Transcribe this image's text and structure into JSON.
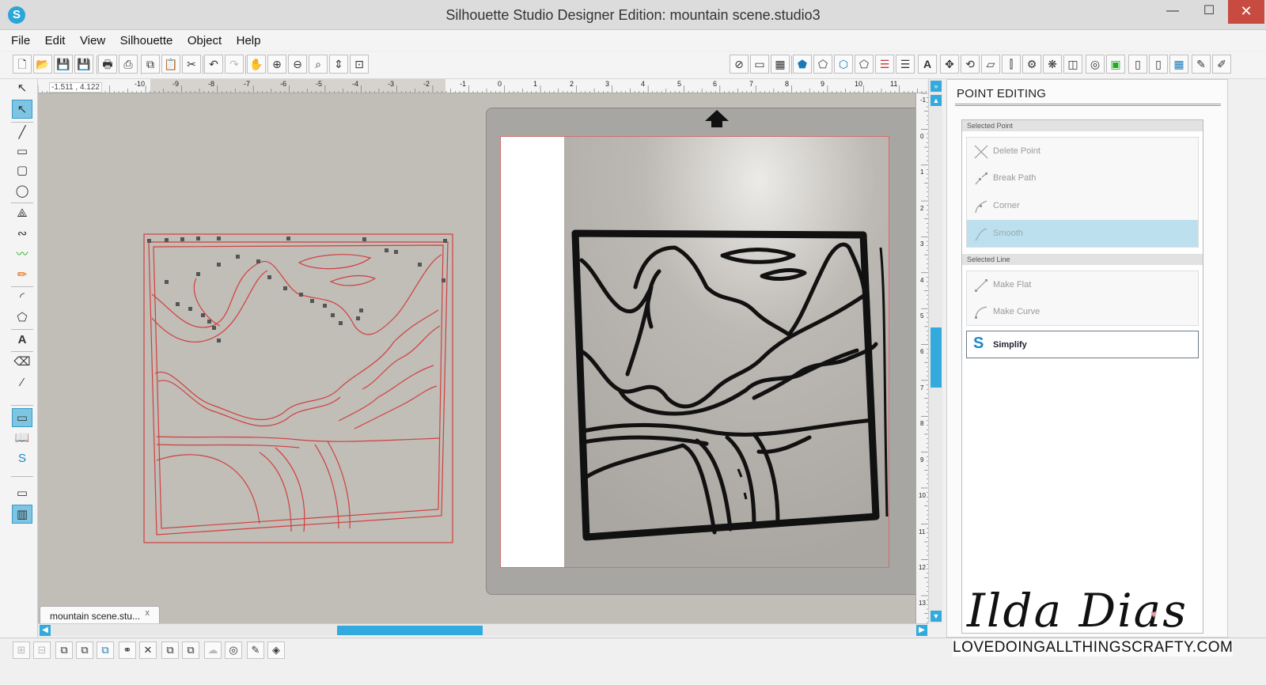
{
  "window": {
    "title": "Silhouette Studio Designer Edition: mountain scene.studio3"
  },
  "menu": [
    "File",
    "Edit",
    "View",
    "Silhouette",
    "Object",
    "Help"
  ],
  "rulers": {
    "coord": "-1.511 , 4.122",
    "h_labels": [
      "-10",
      "-9",
      "-8",
      "-7",
      "-6",
      "-5",
      "-4",
      "-3",
      "-2",
      "-1",
      "0",
      "1",
      "2",
      "3",
      "4",
      "5",
      "6",
      "7",
      "8",
      "9",
      "10",
      "11"
    ],
    "v_labels": [
      "-1",
      "0",
      "1",
      "2",
      "3",
      "4",
      "5",
      "6",
      "7",
      "8",
      "9",
      "10",
      "11",
      "12",
      "13"
    ]
  },
  "document_tab": {
    "label": "mountain scene.stu...",
    "close": "x"
  },
  "panel": {
    "title": "POINT EDITING",
    "selected_point": {
      "header": "Selected Point",
      "items": [
        "Delete Point",
        "Break Path",
        "Corner",
        "Smooth"
      ]
    },
    "selected_line": {
      "header": "Selected Line",
      "items": [
        "Make Flat",
        "Make Curve"
      ]
    },
    "simplify": "Simplify"
  },
  "watermark": {
    "signature": "Ilda Dias",
    "url": "LOVEDOINGALLTHINGSCRAFTY.COM"
  },
  "colors": {
    "accent": "#33aadd",
    "cut_line": "#d04040",
    "close_button": "#c74b40"
  }
}
